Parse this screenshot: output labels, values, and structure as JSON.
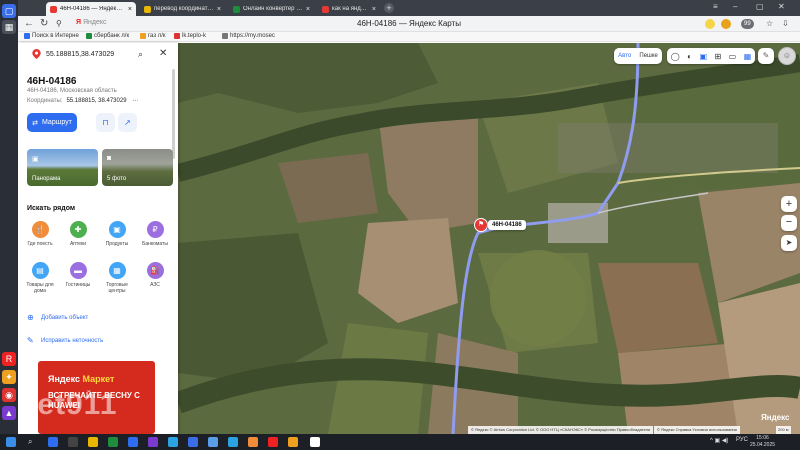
{
  "browser": {
    "tabs": [
      {
        "label": "46Н-04186 — Яндекс Ка",
        "active": true,
        "favicon_color": "#e53935"
      },
      {
        "label": "перевод координат из гр",
        "active": false,
        "favicon_color": "#e8b800"
      },
      {
        "label": "Онлайн конвертер геогр",
        "active": false,
        "favicon_color": "#1e8e3e"
      },
      {
        "label": "как на яндекс картах на",
        "active": false,
        "favicon_color": "#e53935"
      }
    ],
    "address_brand": "Яндекс",
    "page_title": "46Н-04186 — Яндекс Карты",
    "ext_badge": "99",
    "bookmarks": [
      "Поиск в Интерне",
      "сбербанк л/к",
      "газ л/к",
      "lk.teplo-k",
      "https://my.mosec"
    ]
  },
  "search": {
    "query": "55.188815,38.473029",
    "search_icon": "search-icon",
    "close_icon": "close-icon"
  },
  "place": {
    "title": "46Н-04186",
    "subtitle": "46Н-04186, Московская область",
    "coords_label": "Координаты:",
    "coords_value": "55.188815, 38.473029",
    "more": "···",
    "route_label": "Маршрут"
  },
  "photos": {
    "panorama": "Панорама",
    "photos": "5 фото"
  },
  "nearby": {
    "title": "Искать рядом",
    "items": [
      {
        "label": "Где поесть",
        "color": "#f08c3a",
        "icon": "🍴"
      },
      {
        "label": "Аптеки",
        "color": "#4caf50",
        "icon": "✚"
      },
      {
        "label": "Продукты",
        "color": "#42a5f5",
        "icon": "🛒"
      },
      {
        "label": "Банкоматы",
        "color": "#9c6fe0",
        "icon": "₽"
      },
      {
        "label": "Товары для дома",
        "color": "#42a5f5",
        "icon": "▤"
      },
      {
        "label": "Гостиницы",
        "color": "#9c6fe0",
        "icon": "▬"
      },
      {
        "label": "Торговые центры",
        "color": "#42a5f5",
        "icon": "▣"
      },
      {
        "label": "АЗС",
        "color": "#9c6fe0",
        "icon": "⛽"
      }
    ]
  },
  "actions": {
    "add_object": "Добавить объект",
    "fix_error": "Исправить неточность"
  },
  "ad": {
    "brand": "Яндекс",
    "brand2": "Маркет",
    "line": "ВСТРЕЧАЙТЕ ВЕСНУ С HUAWEI"
  },
  "map": {
    "mode_auto": "Авто",
    "mode_walk": "Пешке",
    "marker_label": "46Н-04186",
    "brand": "Яндекс",
    "copyright": "© Яндекс  © Airbus Corporation Ltd.  © ООО НТЦ «СКАНЭКС»  © Росимущество  Правообладатели",
    "links": "© Яндекс  Справка  Условия использования",
    "scale": "200 м"
  },
  "watermark": "net911",
  "taskbar": {
    "lang": "РУС",
    "time": "15:06",
    "date": "25.04.2025"
  }
}
